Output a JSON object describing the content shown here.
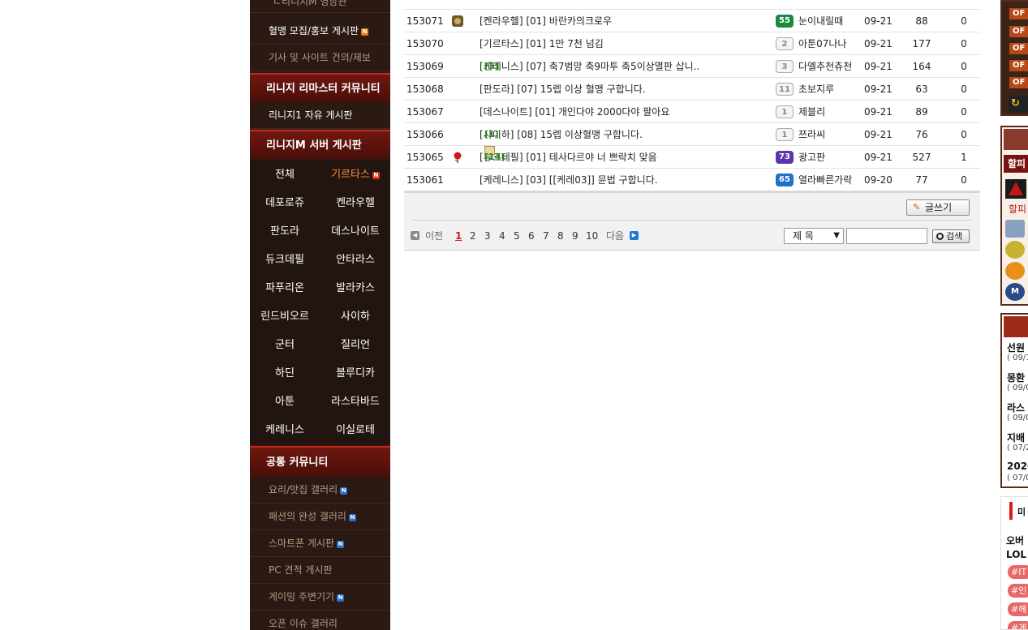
{
  "sidebar": {
    "top_link": "ㄴ리니지M 영상관",
    "recruit_label": "혈맹 모집/홍보 게시판",
    "suggest_label": "기사 및 사이트 건의/제보",
    "remaster_heading": "리니지 리마스터 커뮤니티",
    "remaster_free": "리니지1 자유 게시판",
    "server_heading": "리니지M 서버 게시판",
    "servers": [
      "전체",
      "기르타스",
      "데포로쥬",
      "켄라우헬",
      "판도라",
      "데스나이트",
      "듀크데필",
      "안타라스",
      "파푸리온",
      "발라카스",
      "린드비오르",
      "사이하",
      "군터",
      "질리언",
      "하딘",
      "블루디카",
      "아툰",
      "라스타바드",
      "케레니스",
      "이실로테"
    ],
    "common_heading": "공통 커뮤니티",
    "common_items": [
      "요리/맛집 갤러리",
      "패션의 완성 갤러리",
      "스마트폰 게시판",
      "PC 견적 게시판",
      "게이밍 주변기기",
      "오픈 이슈 갤러리"
    ],
    "new_badge": "N"
  },
  "board": {
    "rows": [
      {
        "no": "153071",
        "title": "[켄라우헬]   [01] 바란카의크로우",
        "count": "",
        "level": "55",
        "nick": "눈이내릴때",
        "date": "09-21",
        "views": "88",
        "rec": "0"
      },
      {
        "no": "153070",
        "title": "[기르타스]   [01] 1만 7천 넘김",
        "count": "",
        "level": "2",
        "nick": "아툰07나나",
        "date": "09-21",
        "views": "177",
        "rec": "0"
      },
      {
        "no": "153069",
        "title": "[케레니스]   [07] 축7범망 축9마투 축5이상멸판 삽니..",
        "count": "[3]",
        "level": "3",
        "nick": "다엘추천츄천",
        "date": "09-21",
        "views": "164",
        "rec": "0"
      },
      {
        "no": "153068",
        "title": "[판도라]   [07] 15렙 이상 혈맹 구합니다.",
        "count": "",
        "level": "11",
        "nick": "초보지루",
        "date": "09-21",
        "views": "63",
        "rec": "0"
      },
      {
        "no": "153067",
        "title": "[데스나이트]   [01] 개인다야 2000다야 팔아요",
        "count": "",
        "level": "1",
        "nick": "제블리",
        "date": "09-21",
        "views": "89",
        "rec": "0"
      },
      {
        "no": "153066",
        "title": "[사이하]   [08] 15렙 이상혈맹 구합니다.",
        "count": "[1]",
        "level": "1",
        "nick": "쯔라씨",
        "date": "09-21",
        "views": "76",
        "rec": "0"
      },
      {
        "no": "153065",
        "title": "[듀크데필]   [01] 테사다르야 너 쁘락치 맞음",
        "count": "[14]",
        "level": "73",
        "nick": "광고판",
        "date": "09-21",
        "views": "527",
        "rec": "1"
      },
      {
        "no": "153061",
        "title": "[케레니스]   [03] [[케레03]] 뮨법 구합니다.",
        "count": "",
        "level": "65",
        "nick": "열라빠른가락",
        "date": "09-20",
        "views": "77",
        "rec": "0"
      }
    ],
    "write_label": "글쓰기",
    "prev_label": "이전",
    "next_label": "다음",
    "pages": [
      "1",
      "2",
      "3",
      "4",
      "5",
      "6",
      "7",
      "8",
      "9",
      "10"
    ],
    "current_page": "1",
    "search_field": "제   목",
    "search_value": "",
    "search_label": "검색"
  },
  "right": {
    "off_label": "OF",
    "hot_label": "할피",
    "hot_sub": "할피",
    "news": [
      {
        "title": "선원",
        "date": "( 09/1"
      },
      {
        "title": "몽환",
        "date": "( 09/0"
      },
      {
        "title": "라스",
        "date": "( 09/0"
      },
      {
        "title": "지배",
        "date": "( 07/2"
      },
      {
        "title": "2020",
        "date": "( 07/0"
      }
    ],
    "ad_title": "미",
    "ad_lines": [
      "오버",
      "LOL"
    ],
    "ad_tags": [
      "#IT",
      "#인",
      "#헤",
      "#게"
    ]
  },
  "colors": {
    "sidebar_bg": "#2a1a13",
    "heading_red": "#6e1810",
    "active_server": "#ff8a3c",
    "page_current": "#d01c1c",
    "comment_count": "#2b8a18"
  }
}
